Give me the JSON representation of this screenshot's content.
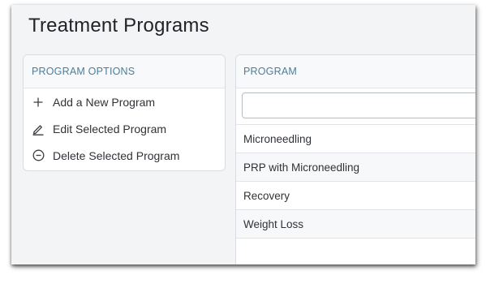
{
  "page": {
    "title": "Treatment Programs"
  },
  "options": {
    "header": "PROGRAM OPTIONS",
    "items": [
      {
        "label": "Add a New Program",
        "icon": "plus-icon"
      },
      {
        "label": "Edit Selected Program",
        "icon": "pencil-icon"
      },
      {
        "label": "Delete Selected Program",
        "icon": "minus-circle-icon"
      }
    ]
  },
  "programs": {
    "header": "PROGRAM",
    "filter_value": "",
    "rows": [
      "Microneedling",
      "PRP with Microneedling",
      "Recovery",
      "Weight Loss"
    ]
  },
  "colors": {
    "accent": "#4d7d99",
    "background": "#f3f4f6"
  }
}
